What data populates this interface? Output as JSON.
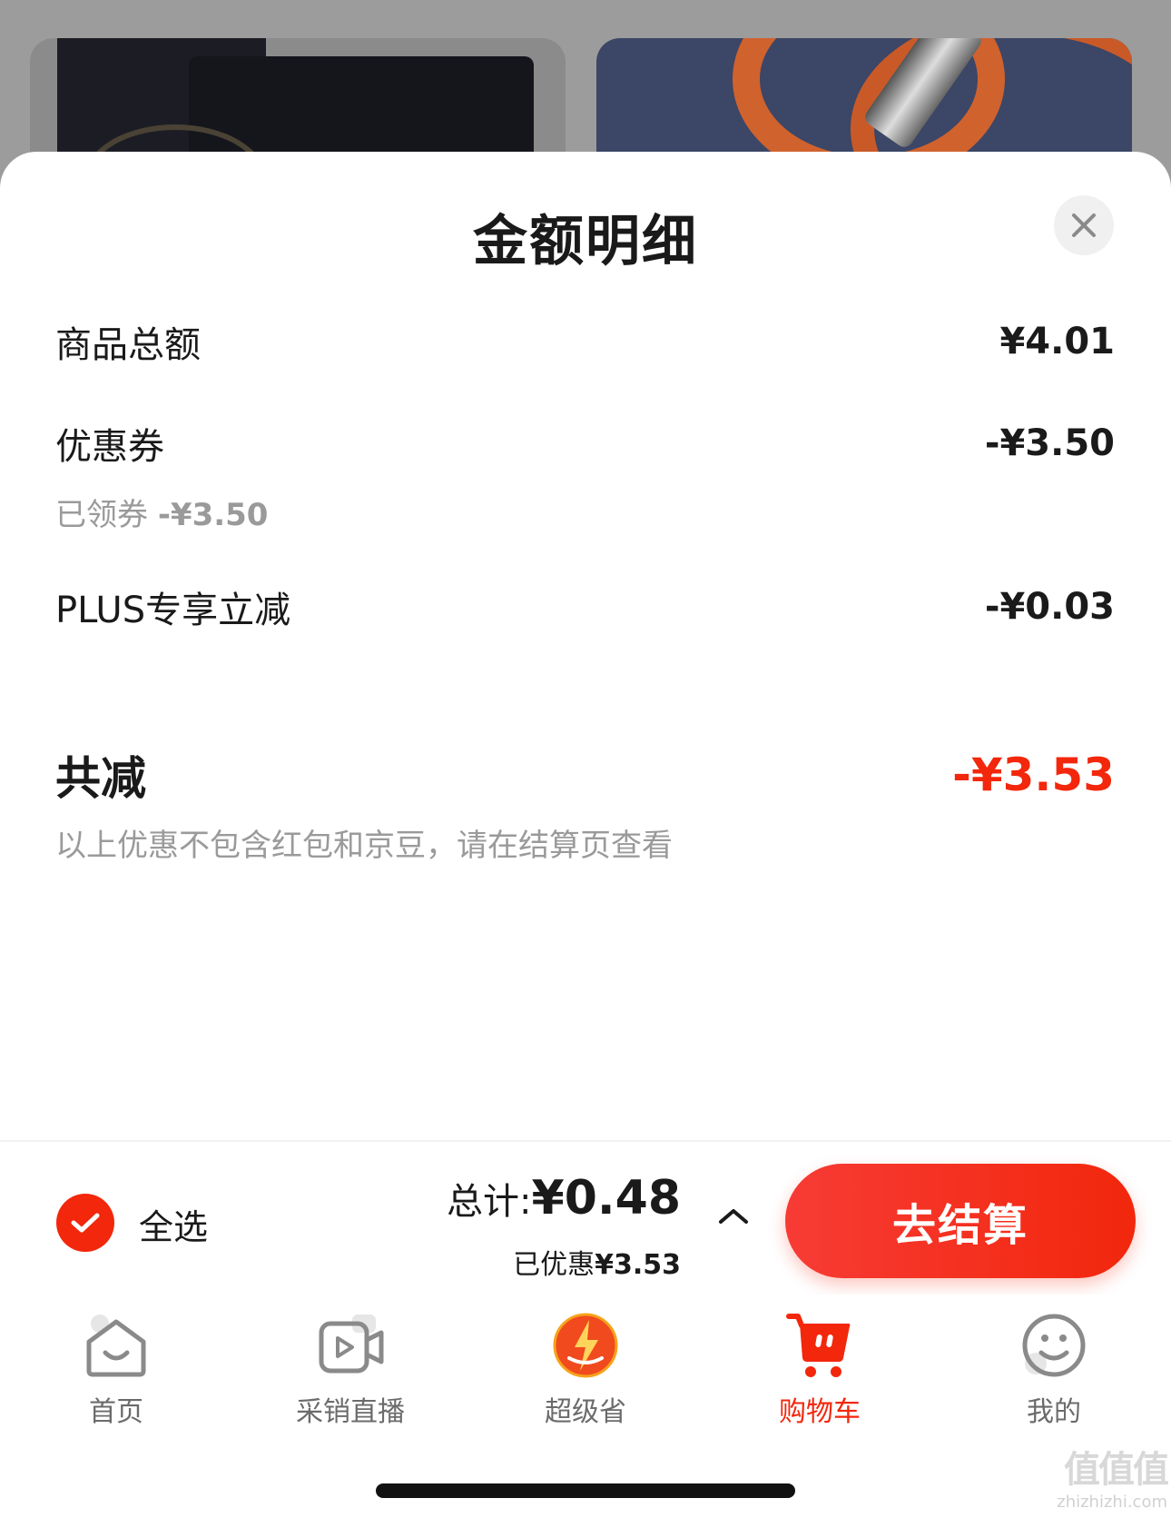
{
  "sheet": {
    "title": "金额明细",
    "close_icon": "close-icon"
  },
  "breakdown": {
    "goods_total": {
      "label": "商品总额",
      "value": "¥4.01"
    },
    "coupon": {
      "label": "优惠券",
      "value": "-¥3.50",
      "note_prefix": "已领券",
      "note_value": "-¥3.50"
    },
    "plus": {
      "label": "PLUS专享立减",
      "value": "-¥0.03"
    },
    "total_discount": {
      "label": "共减",
      "value": "-¥3.53"
    },
    "disclaimer": "以上优惠不包含红包和京豆，请在结算页查看"
  },
  "bottom_bar": {
    "select_all": "全选",
    "total_label": "总计:",
    "total_value": "¥0.48",
    "saved_label": "已优惠",
    "saved_value": "¥3.53",
    "checkout": "去结算",
    "select_all_checked": true
  },
  "tabbar": {
    "items": [
      {
        "label": "首页",
        "icon": "home-icon",
        "active": false
      },
      {
        "label": "采销直播",
        "icon": "live-video-icon",
        "active": false
      },
      {
        "label": "超级省",
        "icon": "super-save-icon",
        "active": false
      },
      {
        "label": "购物车",
        "icon": "cart-icon",
        "active": true
      },
      {
        "label": "我的",
        "icon": "smiley-profile-icon",
        "active": false
      }
    ]
  },
  "watermark": {
    "glyphs": "值值值",
    "site": "zhizhizhi.com"
  },
  "colors": {
    "accent": "#f2270c",
    "muted": "#9a9a9a",
    "backdrop": "#9c9c9c"
  }
}
